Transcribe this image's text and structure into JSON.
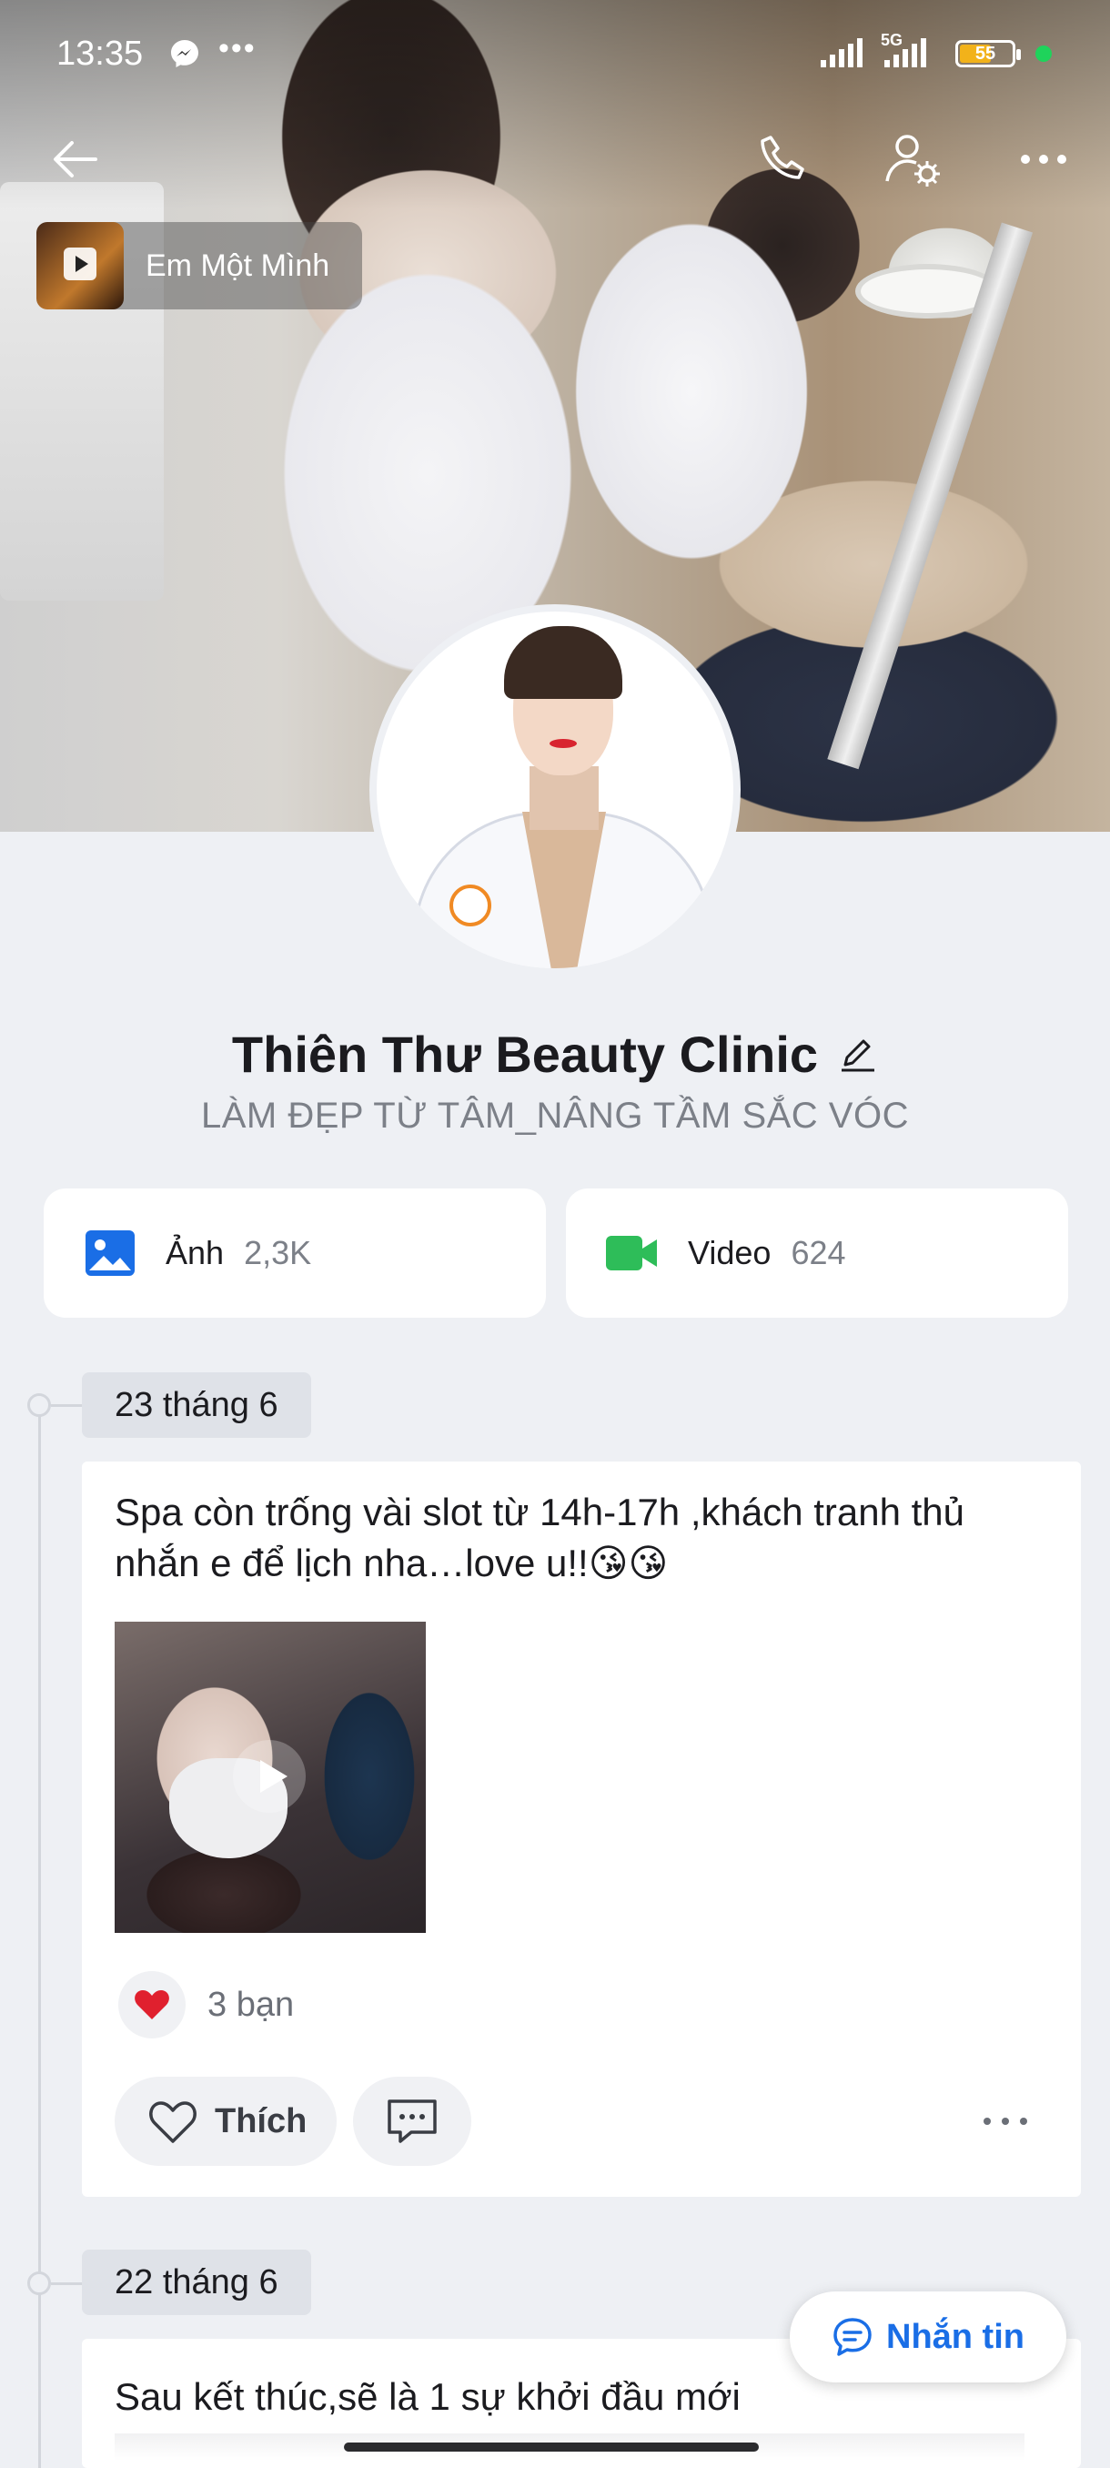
{
  "status_bar": {
    "time": "13:35",
    "network": "5G",
    "battery": "55",
    "icons": [
      "messenger-icon",
      "more-dots-icon",
      "signal-icon",
      "battery-icon"
    ]
  },
  "header": {
    "icons": [
      "back-arrow-icon",
      "phone-icon",
      "user-settings-icon",
      "more-horizontal-icon"
    ],
    "music": {
      "title": "Em Một Mình",
      "icon": "play-icon"
    }
  },
  "profile": {
    "name": "Thiên Thư Beauty Clinic",
    "slogan": "LÀM ĐẸP TỪ TÂM_NÂNG TẦM SẮC VÓC",
    "edit_icon": "pencil-icon"
  },
  "media": {
    "photos": {
      "label": "Ảnh",
      "count": "2,3K",
      "icon": "image-icon",
      "color": "#1a6ee6"
    },
    "videos": {
      "label": "Video",
      "count": "624",
      "icon": "video-camera-icon",
      "color": "#2ebd59"
    }
  },
  "timeline": [
    {
      "date": "23 tháng 6",
      "text": "Spa còn trống vài slot từ 14h-17h ,khách tranh thủ nhắn e để lịch nha…love u!!😘😘",
      "media_type": "video",
      "reaction_icon": "heart-icon",
      "reaction_count": "3 bạn",
      "like_label": "Thích",
      "comment_icon": "comment-icon"
    },
    {
      "date": "22 tháng 6",
      "text": "Sau kết thúc,sẽ là 1 sự khởi đầu mới"
    }
  ],
  "fab": {
    "label": "Nhắn tin",
    "icon": "chat-bubble-icon"
  },
  "colors": {
    "accent": "#1a6ee6",
    "background": "#eef0f4",
    "heart": "#e0202e",
    "video_green": "#2ebd59"
  }
}
